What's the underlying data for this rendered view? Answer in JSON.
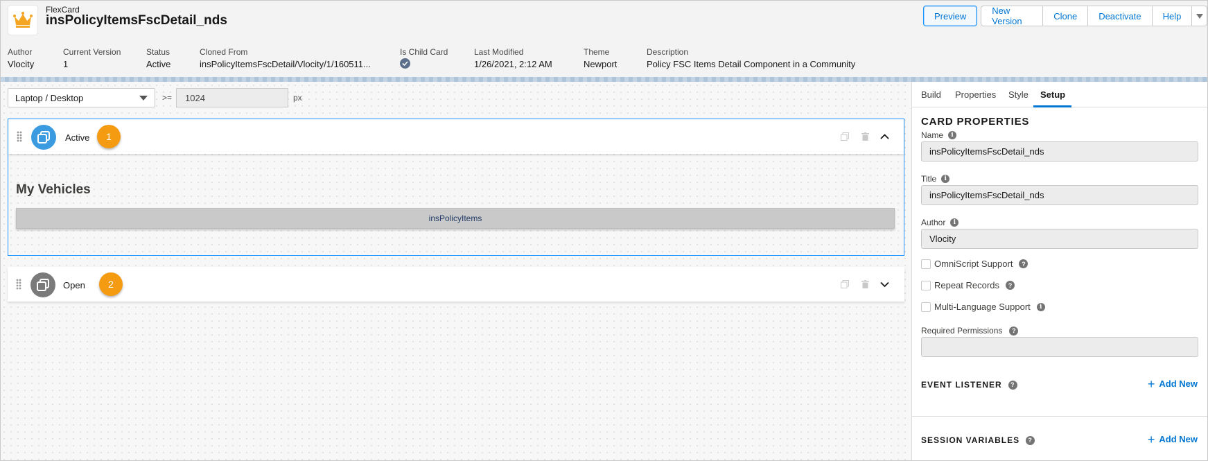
{
  "header": {
    "type_label": "FlexCard",
    "title": "insPolicyItemsFscDetail_nds",
    "buttons": {
      "preview": "Preview",
      "new_version": "New Version",
      "clone": "Clone",
      "deactivate": "Deactivate",
      "help": "Help"
    }
  },
  "meta": {
    "author_label": "Author",
    "author_value": "Vlocity",
    "version_label": "Current Version",
    "version_value": "1",
    "status_label": "Status",
    "status_value": "Active",
    "cloned_label": "Cloned From",
    "cloned_value": "insPolicyItemsFscDetail/Vlocity/1/160511...",
    "child_label": "Is Child Card",
    "modified_label": "Last Modified",
    "modified_value": "1/26/2021, 2:12 AM",
    "theme_label": "Theme",
    "theme_value": "Newport",
    "desc_label": "Description",
    "desc_value": "Policy FSC Items Detail Component in a Community"
  },
  "canvas": {
    "device": "Laptop / Desktop",
    "operator": ">=",
    "width_value": "1024",
    "unit": "px",
    "states": [
      {
        "label": "Active",
        "badge": "1",
        "heading": "My Vehicles",
        "child": "insPolicyItems"
      },
      {
        "label": "Open",
        "badge": "2"
      }
    ]
  },
  "panel": {
    "tabs": [
      "Build",
      "Properties",
      "Style",
      "Setup"
    ],
    "card_properties_title": "CARD PROPERTIES",
    "name_label": "Name",
    "name_value": "insPolicyItemsFscDetail_nds",
    "title_label": "Title",
    "title_value": "insPolicyItemsFscDetail_nds",
    "author_label": "Author",
    "author_value": "Vlocity",
    "checkboxes": [
      "OmniScript Support",
      "Repeat Records",
      "Multi-Language Support"
    ],
    "permissions_label": "Required Permissions",
    "event_listener_title": "EVENT LISTENER",
    "session_variables_title": "SESSION VARIABLES",
    "add_new": "Add New"
  },
  "colors": {
    "accent": "#0176d3",
    "badge": "#f59b12",
    "active_state_icon": "#3a9be0",
    "open_state_icon": "#7a7a7a"
  }
}
